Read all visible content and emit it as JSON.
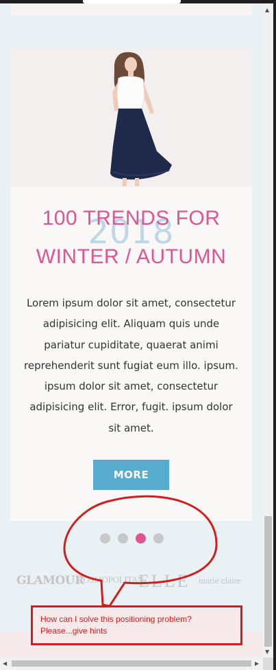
{
  "article": {
    "title_line1": "100 TRENDS FOR",
    "title_line2": "WINTER / AUTUMN",
    "year": "2018",
    "description": "Lorem ipsum dolor sit amet, consectetur adipisicing elit. Aliquam quis unde pariatur cupiditate, quaerat animi reprehenderit sunt fugiat eum illo. ipsum. ipsum dolor sit amet, consectetur adipisicing elit. Error, fugit. ipsum dolor sit amet.",
    "more_label": "MORE"
  },
  "carousel": {
    "dots": 4,
    "active_index": 2
  },
  "brands": [
    "GLAMOUR",
    "COSMOPOLITAN",
    "ELLE",
    "marie claire"
  ],
  "annotation": {
    "line1": "How can I solve this positioning problem?",
    "line2": "Please...give hints"
  },
  "colors": {
    "accent_pink": "#e0558f",
    "button_blue": "#57abcc",
    "page_background": "#e9f1f4",
    "annotation_red": "#d11d1d"
  }
}
